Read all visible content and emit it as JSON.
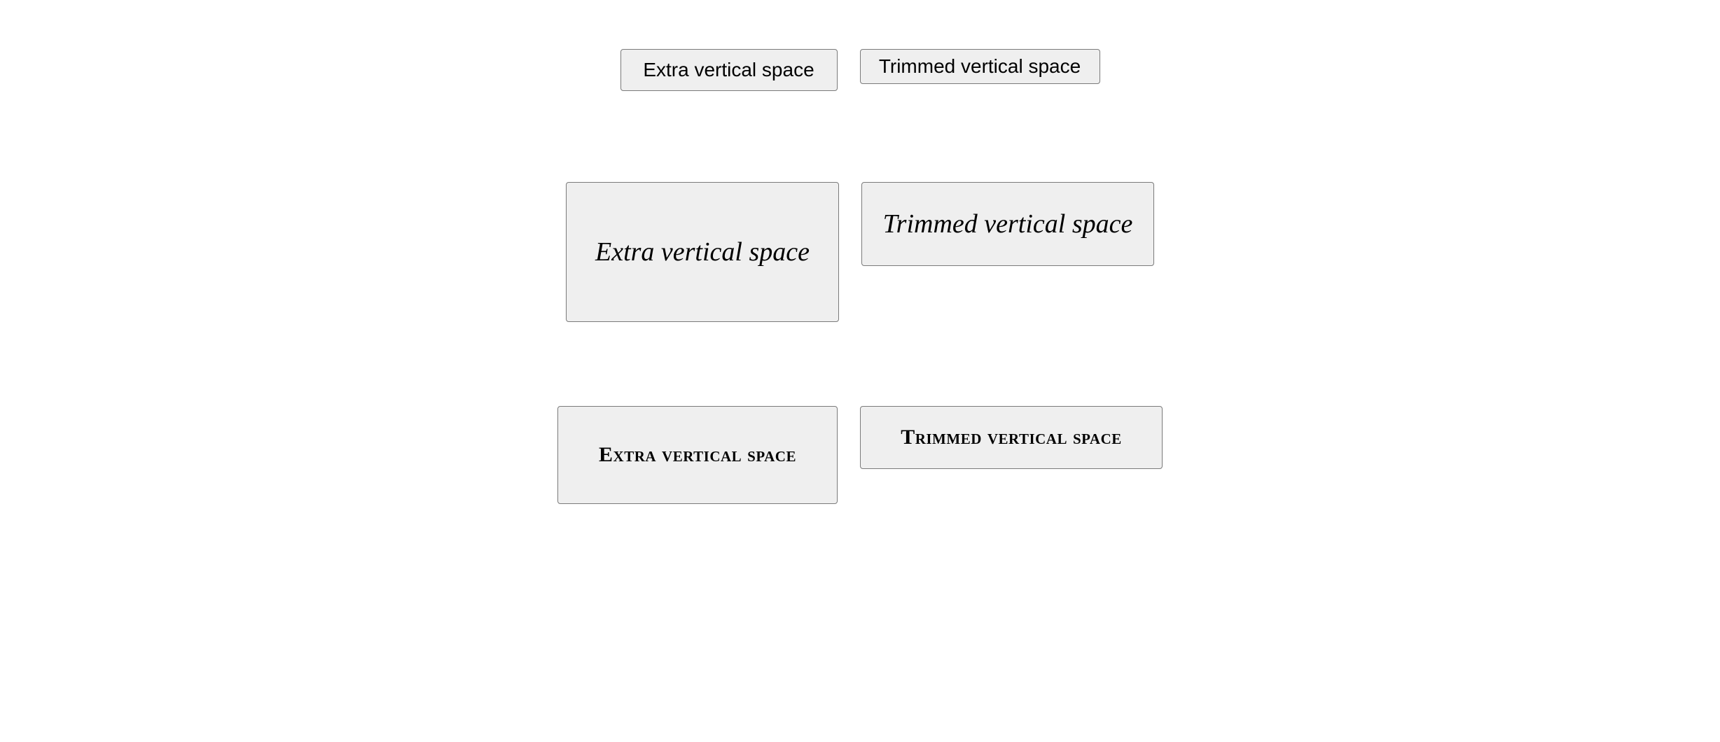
{
  "rows": [
    {
      "extra": "Extra vertical space",
      "trimmed": "Trimmed vertical space"
    },
    {
      "extra": "Extra vertical space",
      "trimmed": "Trimmed vertical space"
    },
    {
      "extra": "Extra vertical space",
      "trimmed": "Trimmed vertical space"
    }
  ]
}
